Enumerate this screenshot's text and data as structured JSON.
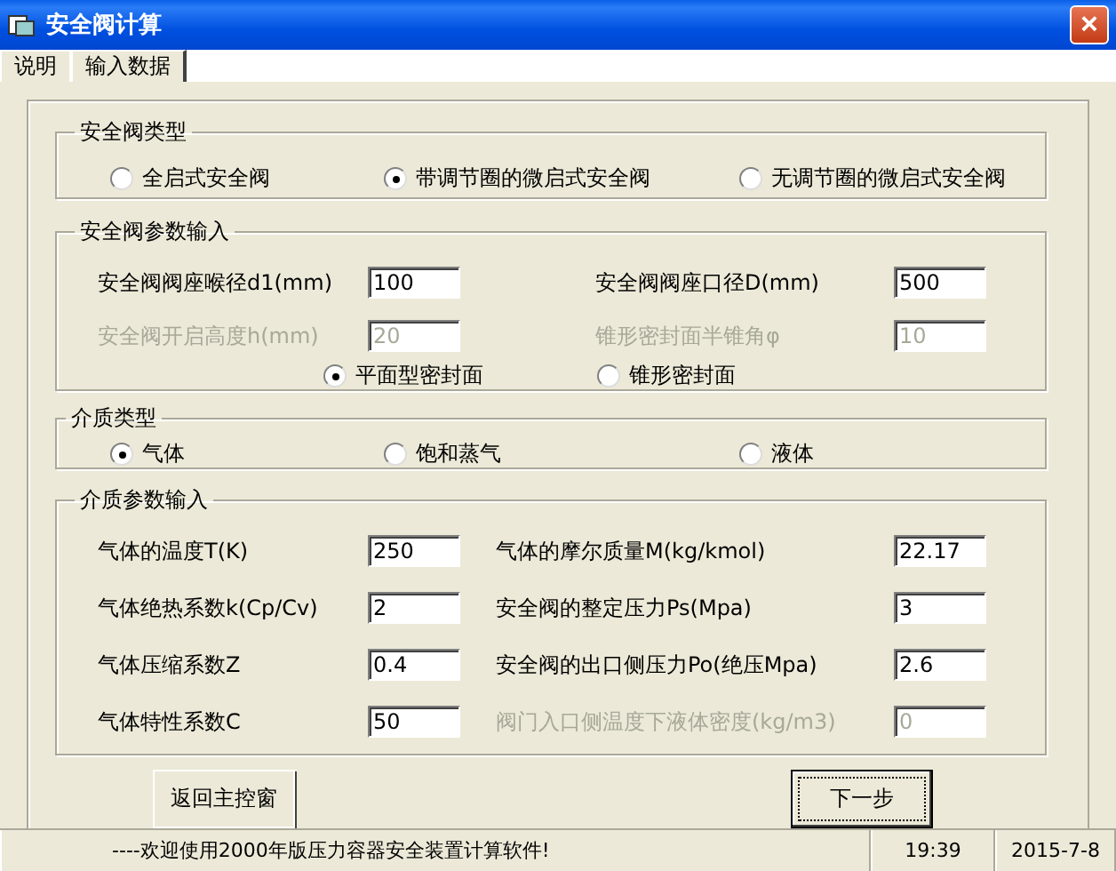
{
  "window": {
    "title": "安全阀计算",
    "close": "×"
  },
  "tabs": [
    {
      "label": "说明",
      "selected": false
    },
    {
      "label": "输入数据",
      "selected": true
    }
  ],
  "valve_type": {
    "title": "安全阀类型",
    "options": [
      {
        "label": "全启式安全阀",
        "selected": false
      },
      {
        "label": "带调节圈的微启式安全阀",
        "selected": true
      },
      {
        "label": "无调节圈的微启式安全阀",
        "selected": false
      }
    ]
  },
  "valve_params": {
    "title": "安全阀参数输入",
    "fields": [
      {
        "label": "安全阀阀座喉径d1(mm)",
        "value": "100",
        "disabled": false
      },
      {
        "label": "安全阀阀座口径D(mm)",
        "value": "500",
        "disabled": false
      },
      {
        "label": "安全阀开启高度h(mm)",
        "value": "20",
        "disabled": true
      },
      {
        "label": "锥形密封面半锥角φ",
        "value": "10",
        "disabled": true
      }
    ],
    "seal_options": [
      {
        "label": "平面型密封面",
        "selected": true
      },
      {
        "label": "锥形密封面",
        "selected": false
      }
    ]
  },
  "medium_type": {
    "title": "介质类型",
    "options": [
      {
        "label": "气体",
        "selected": true
      },
      {
        "label": "饱和蒸气",
        "selected": false
      },
      {
        "label": "液体",
        "selected": false
      }
    ]
  },
  "medium_params": {
    "title": "介质参数输入",
    "fields": [
      {
        "label": "气体的温度T(K)",
        "value": "250",
        "disabled": false
      },
      {
        "label": "气体的摩尔质量M(kg/kmol)",
        "value": "22.17",
        "disabled": false
      },
      {
        "label": "气体绝热系数k(Cp/Cv)",
        "value": "2",
        "disabled": false
      },
      {
        "label": "安全阀的整定压力Ps(Mpa)",
        "value": "3",
        "disabled": false
      },
      {
        "label": "气体压缩系数Z",
        "value": "0.4",
        "disabled": false
      },
      {
        "label": "安全阀的出口侧压力Po(绝压Mpa)",
        "value": "2.6",
        "disabled": false
      },
      {
        "label": "气体特性系数C",
        "value": "50",
        "disabled": false
      },
      {
        "label": "阀门入口侧温度下液体密度(kg/m3)",
        "value": "0",
        "disabled": true
      }
    ]
  },
  "buttons": [
    {
      "label": "返回主控窗",
      "default": false
    },
    {
      "label": "下一步",
      "default": true
    }
  ],
  "status_bar": {
    "message": "----欢迎使用2000年版压力容器安全装置计算软件!",
    "time": "19:39",
    "date": "2015-7-8"
  }
}
